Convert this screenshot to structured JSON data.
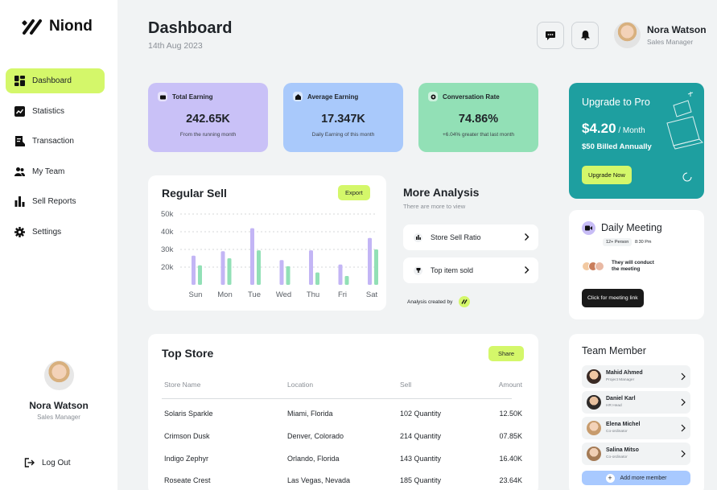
{
  "brand": {
    "name": "Niond"
  },
  "sidebar": {
    "items": [
      {
        "label": "Dashboard",
        "icon": "grid-icon",
        "active": true
      },
      {
        "label": "Statistics",
        "icon": "chart-icon"
      },
      {
        "label": "Transaction",
        "icon": "receipt-icon"
      },
      {
        "label": "My Team",
        "icon": "team-icon"
      },
      {
        "label": "Sell Reports",
        "icon": "bar-chart-icon"
      },
      {
        "label": "Settings",
        "icon": "gear-icon"
      }
    ],
    "profile": {
      "name": "Nora Watson",
      "role": "Sales Manager"
    },
    "logout_label": "Log Out"
  },
  "header": {
    "title": "Dashboard",
    "date": "14th Aug 2023",
    "user": {
      "name": "Nora Watson",
      "role": "Sales Manager"
    }
  },
  "stats": [
    {
      "label": "Total Earning",
      "value": "242.65K",
      "sub": "From the running month",
      "color": "#c9c1f7"
    },
    {
      "label": "Average Earning",
      "value": "17.347K",
      "sub": "Daily Earning of this month",
      "color": "#a9c9fb"
    },
    {
      "label": "Conversation Rate",
      "value": "74.86%",
      "sub": "+6.04% greater that last month",
      "color": "#92e0b6"
    }
  ],
  "regular_sell": {
    "title": "Regular Sell",
    "export_label": "Export"
  },
  "chart_data": {
    "type": "bar",
    "categories": [
      "Sun",
      "Mon",
      "Tue",
      "Wed",
      "Thu",
      "Fri",
      "Sat"
    ],
    "series": [
      {
        "values": [
          26.5,
          29,
          42,
          24,
          29.5,
          21.5,
          36.5
        ],
        "color": "#c3b5f5"
      },
      {
        "values": [
          21,
          25,
          29.5,
          20.5,
          17,
          15,
          30
        ],
        "color": "#92e0b6"
      }
    ],
    "yticks": [
      "50k",
      "40k",
      "30k",
      "20k"
    ],
    "ylim": [
      10,
      50
    ],
    "grid": true
  },
  "more_analysis": {
    "title": "More  Analysis",
    "subtitle": "There are more to view",
    "items": [
      {
        "label": "Store Sell Ratio"
      },
      {
        "label": "Top item sold"
      }
    ],
    "credit": "Analysis created by"
  },
  "top_store": {
    "title": "Top Store",
    "share_label": "Share",
    "columns": [
      "Store Name",
      "Location",
      "Sell",
      "Amount"
    ],
    "rows": [
      [
        "Solaris Sparkle",
        "Miami, Florida",
        "102 Quantity",
        "12.50K"
      ],
      [
        "Crimson Dusk",
        "Denver, Colorado",
        "214 Quantity",
        "07.85K"
      ],
      [
        "Indigo Zephyr",
        "Orlando, Florida",
        "143 Quantity",
        "16.40K"
      ],
      [
        "Roseate Crest",
        "Las Vegas, Nevada",
        "185 Quantity",
        "23.64K"
      ]
    ]
  },
  "upgrade": {
    "title": "Upgrade to Pro",
    "price": "$4.20",
    "period": " / Month",
    "billing": "$50 Billed Annually",
    "button": "Upgrade Now"
  },
  "meeting": {
    "title": "Daily Meeting",
    "tags": [
      "12+ Person",
      "8:30 Pm"
    ],
    "text_line1": "They will conduct",
    "text_line2": "the meeting",
    "button": "Click for meeting link"
  },
  "team": {
    "title": "Team Member",
    "members": [
      {
        "name": "Mahid Ahmed",
        "role": "Project Manager"
      },
      {
        "name": "Daniel Karl",
        "role": "HR Head"
      },
      {
        "name": "Elena Michel",
        "role": "Co-ordinator"
      },
      {
        "name": "Salina Mitso",
        "role": "Co-ordinator"
      }
    ],
    "add_label": "Add more member"
  }
}
